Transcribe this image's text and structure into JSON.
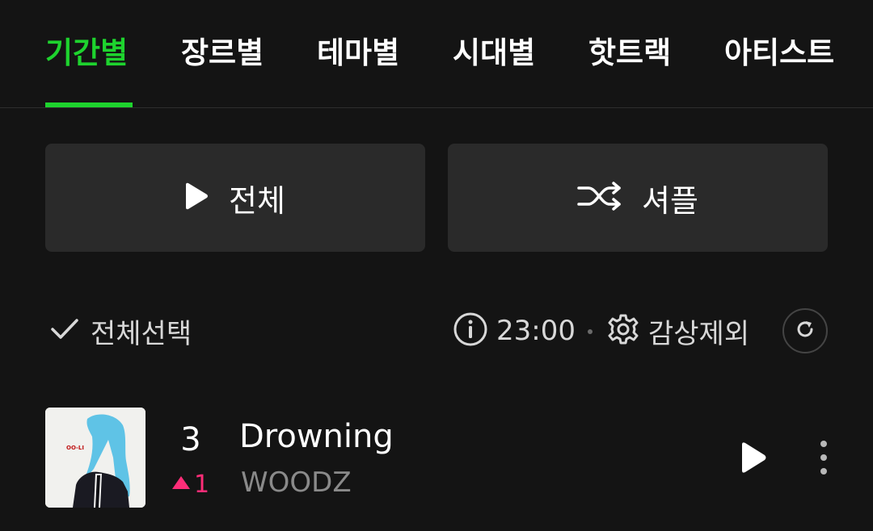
{
  "tabs": [
    {
      "label": "기간별",
      "active": true
    },
    {
      "label": "장르별",
      "active": false
    },
    {
      "label": "테마별",
      "active": false
    },
    {
      "label": "시대별",
      "active": false
    },
    {
      "label": "핫트랙",
      "active": false
    },
    {
      "label": "아티스트",
      "active": false
    }
  ],
  "actions": {
    "play_all_label": "전체",
    "shuffle_label": "셔플"
  },
  "toolbar": {
    "select_all_label": "전체선택",
    "time_label": "23:00",
    "exclude_label": "감상제외"
  },
  "songs": [
    {
      "rank": "3",
      "rank_change": "1",
      "rank_change_direction": "up",
      "title": "Drowning",
      "artist": "WOODZ",
      "cover_text": "OO-LI"
    }
  ],
  "colors": {
    "accent": "#1ed32e",
    "rank_up": "#ff2d78",
    "background": "#141414",
    "button_bg": "#2a2a2a"
  }
}
